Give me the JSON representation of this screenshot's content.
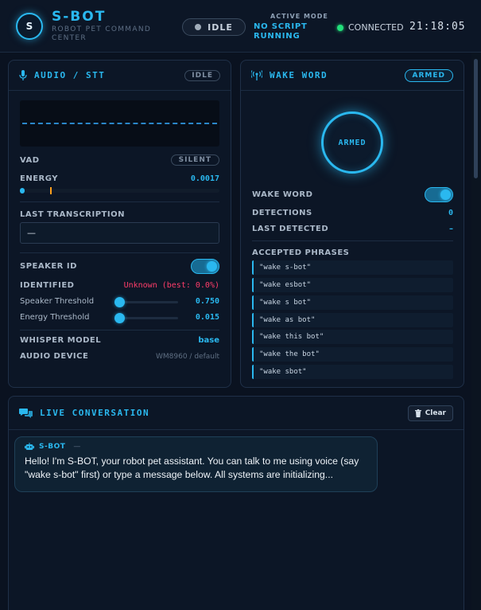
{
  "header": {
    "logo_letter": "S",
    "title": "S-BOT",
    "subtitle": "ROBOT PET COMMAND CENTER",
    "status": "IDLE",
    "active_mode_label": "ACTIVE MODE",
    "active_mode_value": "NO SCRIPT RUNNING",
    "connection": "CONNECTED",
    "clock": "21:18:05"
  },
  "audio": {
    "title": "AUDIO / STT",
    "status_badge": "IDLE",
    "vad_label": "VAD",
    "vad_value": "SILENT",
    "energy_label": "ENERGY",
    "energy_value": "0.0017",
    "energy_level": 0.02,
    "energy_threshold_marker": 0.15,
    "last_transcription_label": "LAST TRANSCRIPTION",
    "last_transcription_value": "—",
    "speaker_id_label": "SPEAKER ID",
    "speaker_id_on": true,
    "identified_label": "IDENTIFIED",
    "identified_value": "Unknown (best: 0.0%)",
    "speaker_threshold_label": "Speaker Threshold",
    "speaker_threshold_value": "0.750",
    "speaker_threshold_level": 0.0,
    "energy_threshold_label": "Energy Threshold",
    "energy_threshold_value": "0.015",
    "energy_threshold_level": 0.0,
    "whisper_model_label": "WHISPER MODEL",
    "whisper_model_value": "base",
    "audio_device_label": "AUDIO DEVICE",
    "audio_device_value": "WM8960 / default"
  },
  "wake": {
    "title": "WAKE WORD",
    "status_badge": "ARMED",
    "ring_label": "ARMED",
    "wake_word_label": "WAKE WORD",
    "wake_word_on": true,
    "detections_label": "DETECTIONS",
    "detections_value": "0",
    "last_detected_label": "LAST DETECTED",
    "last_detected_value": "–",
    "accepted_label": "ACCEPTED PHRASES",
    "phrases": [
      "\"wake s-bot\"",
      "\"wake esbot\"",
      "\"wake s bot\"",
      "\"wake as bot\"",
      "\"wake this bot\"",
      "\"wake the bot\"",
      "\"wake sbot\""
    ]
  },
  "conversation": {
    "title": "LIVE CONVERSATION",
    "clear_label": "Clear",
    "messages": [
      {
        "sender": "S-BOT",
        "time": "—",
        "text": "Hello! I'm S-BOT, your robot pet assistant. You can talk to me using voice (say \"wake s-bot\" first) or type a message below. All systems are initializing..."
      }
    ]
  },
  "colors": {
    "accent": "#2ab8ef",
    "background": "#0a1220",
    "panel": "#0c1626",
    "connected": "#22e07a",
    "alert": "#ff3d6a",
    "energy_marker": "#ff9f1c"
  }
}
